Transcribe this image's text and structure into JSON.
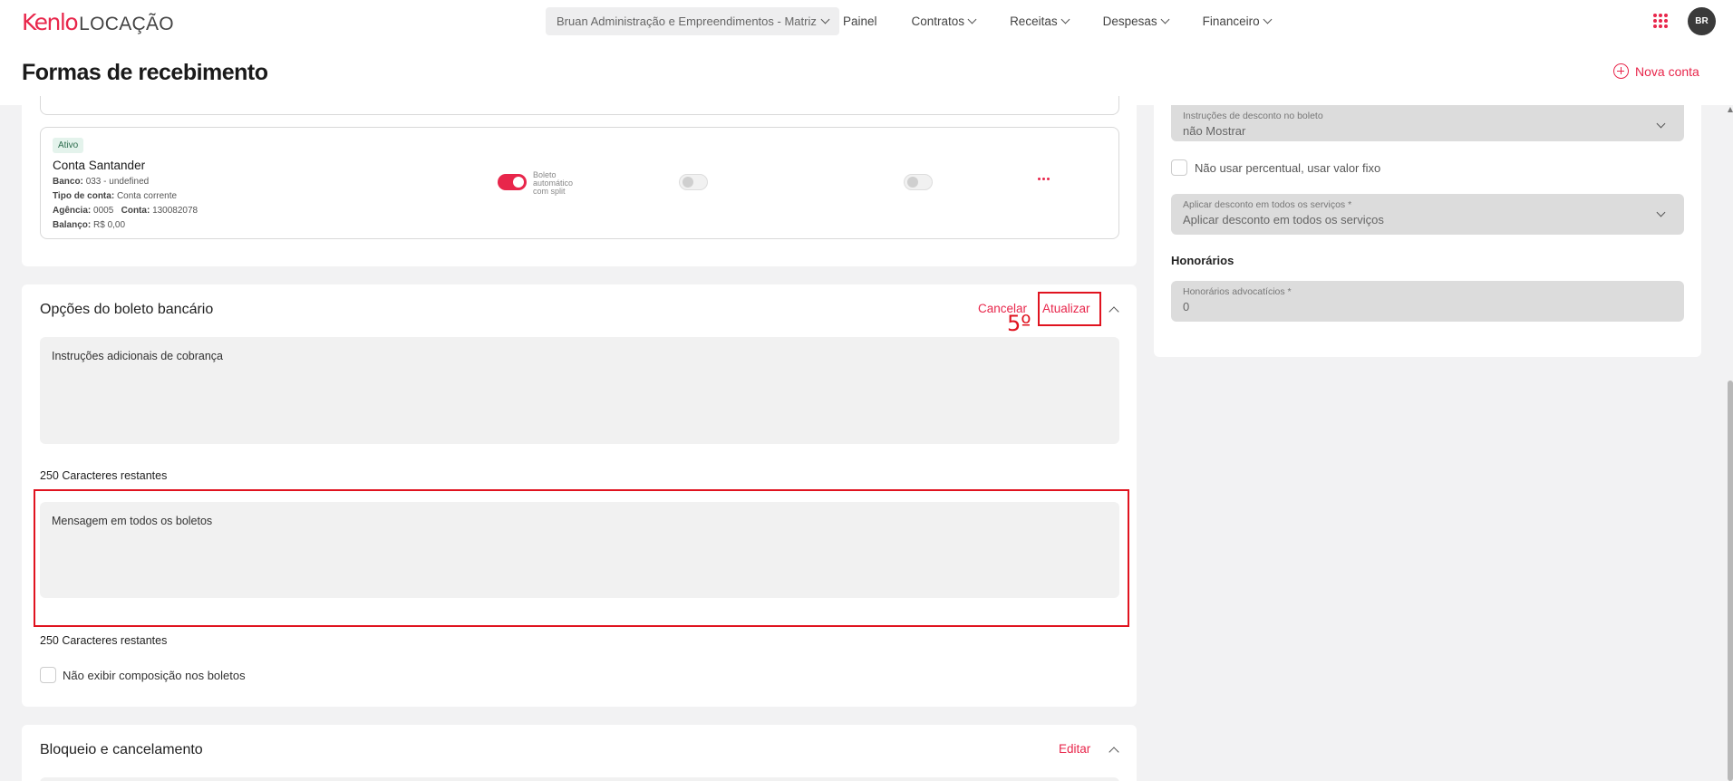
{
  "app": {
    "brand": "Kenlo",
    "product": "LOCAÇÃO"
  },
  "topbar": {
    "company": "Bruan Administração e Empreendimentos - Matriz",
    "nav": [
      {
        "label": "Painel"
      },
      {
        "label": "Contratos"
      },
      {
        "label": "Receitas"
      },
      {
        "label": "Despesas"
      },
      {
        "label": "Financeiro"
      }
    ],
    "avatar": "BR"
  },
  "header": {
    "title": "Formas de recebimento",
    "new_account": "Nova conta"
  },
  "bank_account": {
    "status": "Ativo",
    "name": "Conta Santander",
    "bank_label": "Banco:",
    "bank_value": "033 - undefined",
    "type_label": "Tipo de conta:",
    "type_value": "Conta corrente",
    "agency_label": "Agência:",
    "agency_value": "0005",
    "account_label": "Conta:",
    "account_value": "130082078",
    "balance_label": "Balanço:",
    "balance_value": "R$ 0,00",
    "toggle_label": "Boleto automático com split"
  },
  "boleto_options": {
    "title": "Opções do boleto bancário",
    "cancel": "Cancelar",
    "update": "Atualizar",
    "annotation": "5º",
    "instructions_label": "Instruções adicionais de cobrança",
    "instructions_remaining": "250 Caracteres restantes",
    "message_label": "Mensagem em todos os boletos",
    "message_remaining": "250 Caracteres restantes",
    "no_composition_label": "Não exibir composição nos boletos"
  },
  "blocking": {
    "title": "Bloqueio e cancelamento",
    "edit": "Editar"
  },
  "right_panel": {
    "discount_instructions_label": "Instruções de desconto no boleto",
    "discount_instructions_value": "não Mostrar",
    "fixed_value_label": "Não usar percentual, usar valor fixo",
    "apply_discount_label": "Aplicar desconto em todos os serviços *",
    "apply_discount_value": "Aplicar desconto em todos os serviços",
    "fees_heading": "Honorários",
    "legal_fees_label": "Honorários advocatícios *",
    "legal_fees_value": "0"
  },
  "colors": {
    "accent": "#e8264b",
    "annotation": "#e0131f",
    "badge_bg": "#e4f3ec"
  },
  "icons": [
    "chevron-down-icon",
    "apps-grid-icon",
    "plus-circle-icon",
    "kebab-menu-icon",
    "chevron-up-icon"
  ]
}
